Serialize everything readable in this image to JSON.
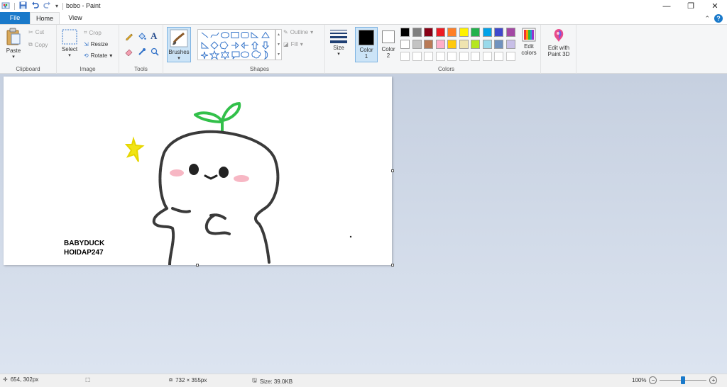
{
  "title_bar": {
    "document_name": "bobo - Paint",
    "controls": [
      "minimize",
      "restore",
      "close"
    ]
  },
  "tabs": [
    {
      "label": "File",
      "active": false
    },
    {
      "label": "Home",
      "active": true
    },
    {
      "label": "View",
      "active": false
    }
  ],
  "ribbon": {
    "clipboard": {
      "paste": "Paste",
      "cut": "Cut",
      "copy": "Copy",
      "group_label": "Clipboard"
    },
    "image": {
      "select": "Select",
      "crop": "Crop",
      "resize": "Resize",
      "rotate": "Rotate",
      "group_label": "Image"
    },
    "tools": {
      "group_label": "Tools"
    },
    "brushes": {
      "label": "Brushes"
    },
    "shapes": {
      "outline": "Outline",
      "fill": "Fill",
      "group_label": "Shapes"
    },
    "size": {
      "label": "Size"
    },
    "colors": {
      "color1_label": "Color",
      "color1_num": "1",
      "color2_label": "Color",
      "color2_num": "2",
      "color1": "#000000",
      "color2": "#ffffff",
      "edit_colors_line1": "Edit",
      "edit_colors_line2": "colors",
      "group_label": "Colors",
      "palette_row1": [
        "#000000",
        "#7f7f7f",
        "#880015",
        "#ed1c24",
        "#ff7f27",
        "#fff200",
        "#22b14c",
        "#00a2e8",
        "#3f48cc",
        "#a349a4"
      ],
      "palette_row2": [
        "#ffffff",
        "#c3c3c3",
        "#b97a57",
        "#ffaec9",
        "#ffc90e",
        "#efe4b0",
        "#b5e61d",
        "#99d9ea",
        "#7092be",
        "#c8bfe7"
      ],
      "palette_row3": [
        "#ffffff",
        "#ffffff",
        "#ffffff",
        "#ffffff",
        "#ffffff",
        "#ffffff",
        "#ffffff",
        "#ffffff",
        "#ffffff",
        "#ffffff"
      ]
    },
    "paint3d": {
      "line1": "Edit with",
      "line2": "Paint 3D"
    }
  },
  "canvas": {
    "text_line1": "BABYDUCK",
    "text_line2": "HOIDAP247"
  },
  "status_bar": {
    "cursor_position": "654, 302px",
    "image_dimensions": "732 × 355px",
    "file_size": "Size: 39.0KB",
    "zoom": "100%"
  }
}
